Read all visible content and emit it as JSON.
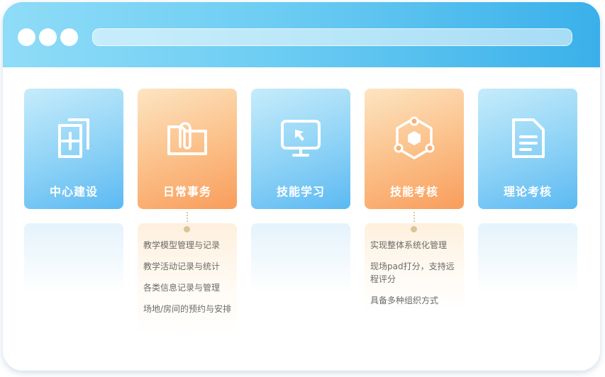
{
  "browser": {
    "window_controls": [
      "dot",
      "dot",
      "dot"
    ]
  },
  "cards": [
    {
      "label": "中心建设",
      "icon": "document-add-icon",
      "color": "blue"
    },
    {
      "label": "日常事务",
      "icon": "folder-clip-icon",
      "color": "orange"
    },
    {
      "label": "技能学习",
      "icon": "monitor-cursor-icon",
      "color": "blue"
    },
    {
      "label": "技能考核",
      "icon": "network-hexagon-icon",
      "color": "orange"
    },
    {
      "label": "理论考核",
      "icon": "document-text-icon",
      "color": "blue"
    }
  ],
  "features": {
    "daily_affairs": [
      "教学模型管理与记录",
      "教学活动记录与统计",
      "各类信息记录与管理",
      "场地/房间的预约与安排"
    ],
    "skill_assessment": [
      "实现整体系统化管理",
      "现场pad打分，支持远程评分",
      "具备多种组织方式"
    ]
  },
  "colors": {
    "titlebar_start": "#8fdcf7",
    "titlebar_end": "#3ab0ea",
    "card_blue": "#5cb9f2",
    "card_orange": "#f89d5c"
  }
}
